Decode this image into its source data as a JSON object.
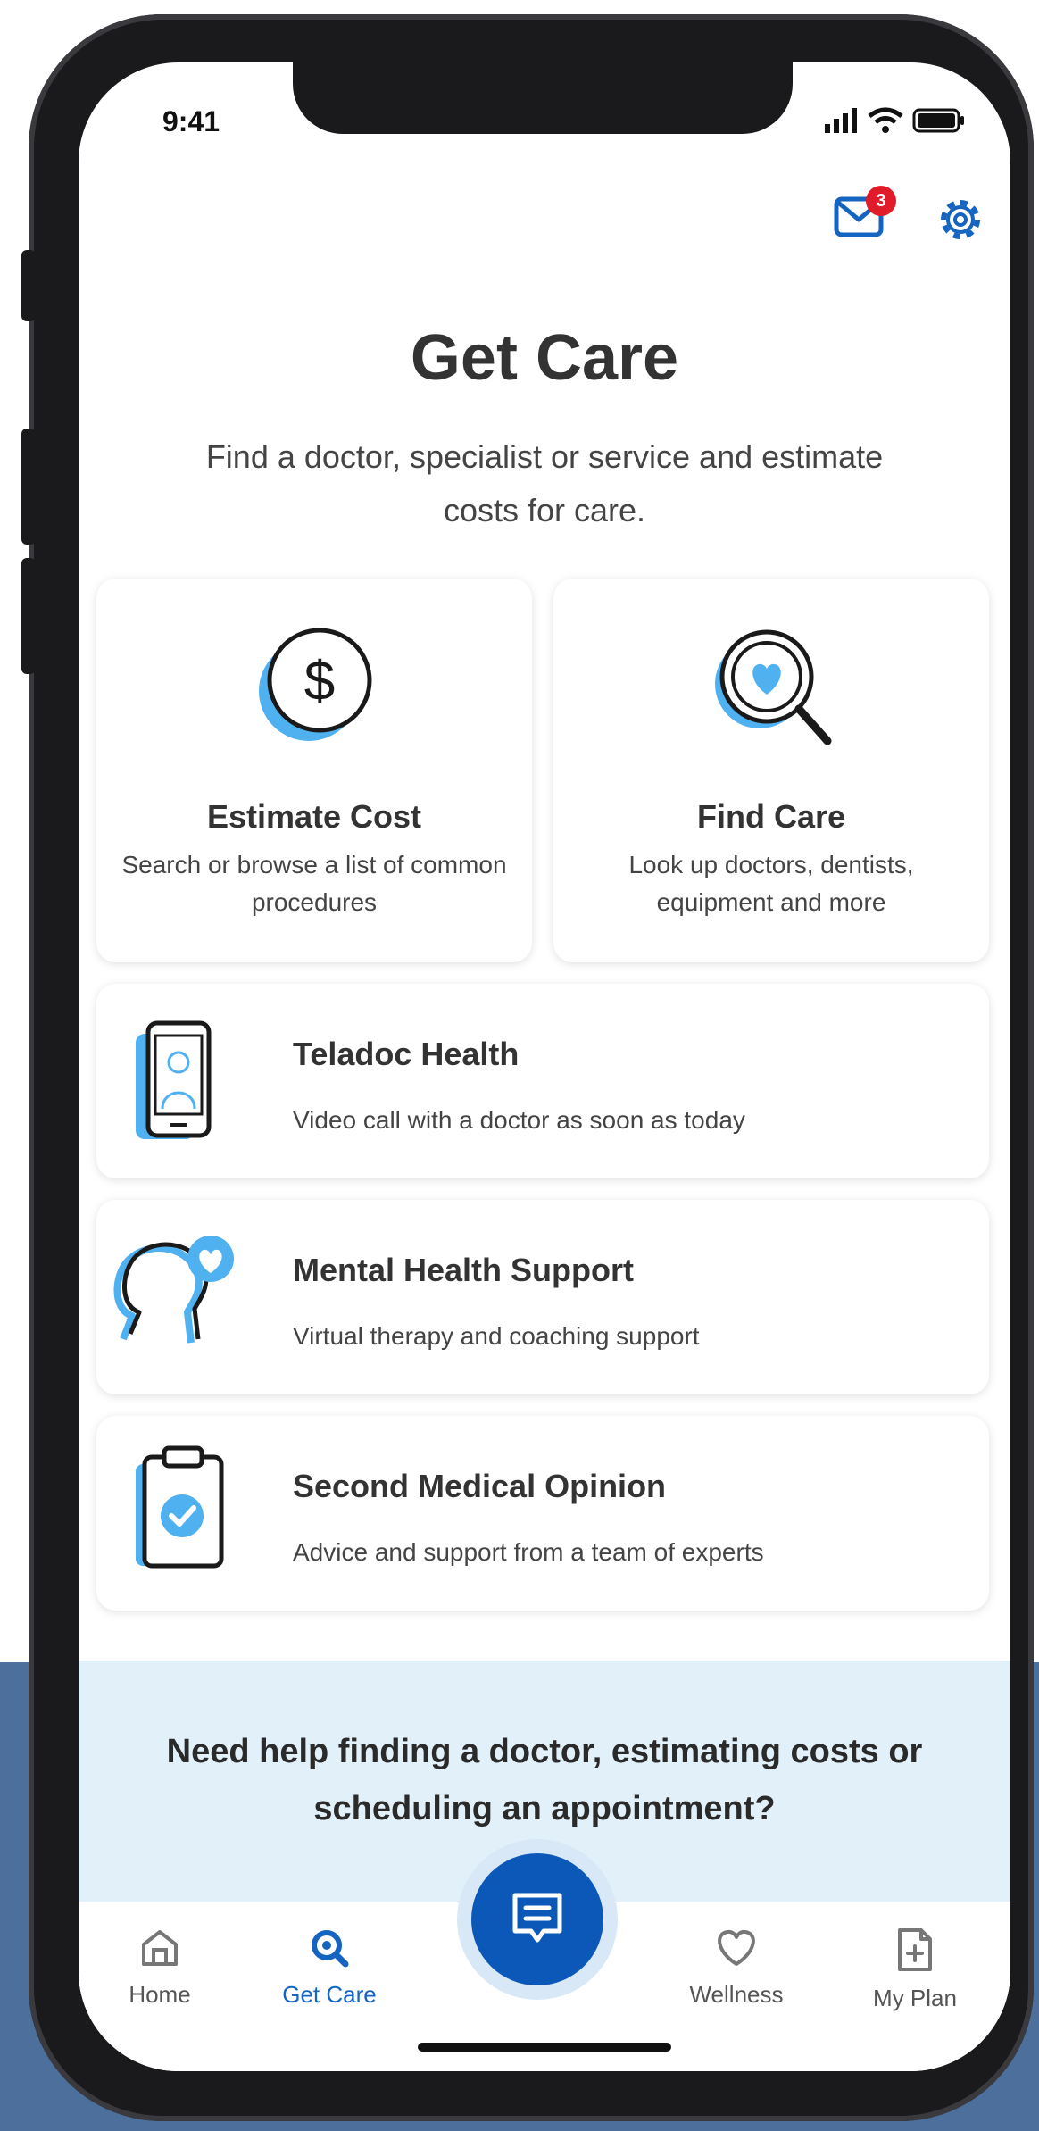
{
  "status_bar": {
    "time": "9:41"
  },
  "header": {
    "notification_count": "3"
  },
  "page": {
    "title": "Get Care",
    "subtitle": "Find a doctor, specialist or service and estimate costs for care."
  },
  "tiles": [
    {
      "title": "Estimate Cost",
      "description": "Search or browse a list of common procedures",
      "icon": "dollar-icon"
    },
    {
      "title": "Find Care",
      "description": "Look up doctors, dentists, equipment and more",
      "icon": "magnifier-heart-icon"
    }
  ],
  "services": [
    {
      "title": "Teladoc Health",
      "description": "Video call with a doctor as soon as today",
      "icon": "phone-doctor-icon"
    },
    {
      "title": "Mental Health Support",
      "description": "Virtual therapy and coaching support",
      "icon": "head-heart-icon"
    },
    {
      "title": "Second Medical Opinion",
      "description": "Advice and support from a team of experts",
      "icon": "clipboard-check-icon"
    }
  ],
  "help": {
    "text": "Need help finding a doctor, estimating costs or scheduling an appointment?"
  },
  "nav": {
    "home": "Home",
    "get_care": "Get Care",
    "wellness": "Wellness",
    "my_plan": "My Plan"
  },
  "colors": {
    "accent": "#1565c0",
    "accent_light": "#4fb1f0",
    "badge": "#e01b2a",
    "background_band": "#4c6f9b"
  }
}
